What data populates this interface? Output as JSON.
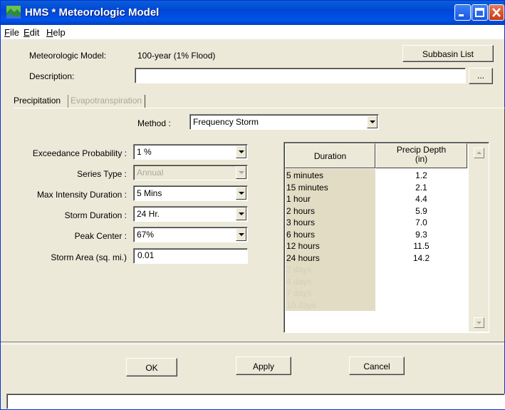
{
  "window": {
    "title": "HMS * Meteorologic Model",
    "accent": "#0054e3"
  },
  "menu": [
    "File",
    "Edit",
    "Help"
  ],
  "header": {
    "model_label": "Meteorologic Model:",
    "model_value": "100-year (1% Flood)",
    "subbasin_button": "Subbasin List",
    "description_label": "Description:",
    "description_value": "",
    "ellipsis_button": "..."
  },
  "tabs": [
    {
      "label": "Precipitation",
      "active": true
    },
    {
      "label": "Evapotranspiration",
      "active": false
    }
  ],
  "method": {
    "label": "Method :",
    "value": "Frequency Storm"
  },
  "fields": {
    "exceedance": {
      "label": "Exceedance Probability :",
      "value": "1 %"
    },
    "series_type": {
      "label": "Series Type :",
      "value": "Annual"
    },
    "max_intensity": {
      "label": "Max Intensity Duration :",
      "value": "5 Mins"
    },
    "storm_duration": {
      "label": "Storm Duration :",
      "value": "24 Hr."
    },
    "peak_center": {
      "label": "Peak Center :",
      "value": "67%"
    },
    "storm_area": {
      "label": "Storm Area (sq. mi.)",
      "value": "0.01"
    }
  },
  "table": {
    "col_duration": "Duration",
    "col_depth": "Precip Depth\n(in)",
    "rows": [
      {
        "duration": "5 minutes",
        "depth": "1.2",
        "enabled": true
      },
      {
        "duration": "15 minutes",
        "depth": "2.1",
        "enabled": true
      },
      {
        "duration": "1 hour",
        "depth": "4.4",
        "enabled": true
      },
      {
        "duration": "2 hours",
        "depth": "5.9",
        "enabled": true
      },
      {
        "duration": "3 hours",
        "depth": "7.0",
        "enabled": true
      },
      {
        "duration": "6 hours",
        "depth": "9.3",
        "enabled": true
      },
      {
        "duration": "12 hours",
        "depth": "11.5",
        "enabled": true
      },
      {
        "duration": "24 hours",
        "depth": "14.2",
        "enabled": true
      },
      {
        "duration": "2 days",
        "depth": "",
        "enabled": false
      },
      {
        "duration": "4 days",
        "depth": "",
        "enabled": false
      },
      {
        "duration": "7 days",
        "depth": "",
        "enabled": false
      },
      {
        "duration": "10 days",
        "depth": "",
        "enabled": false
      }
    ]
  },
  "buttons": {
    "ok": "OK",
    "apply": "Apply",
    "cancel": "Cancel"
  },
  "status": ""
}
